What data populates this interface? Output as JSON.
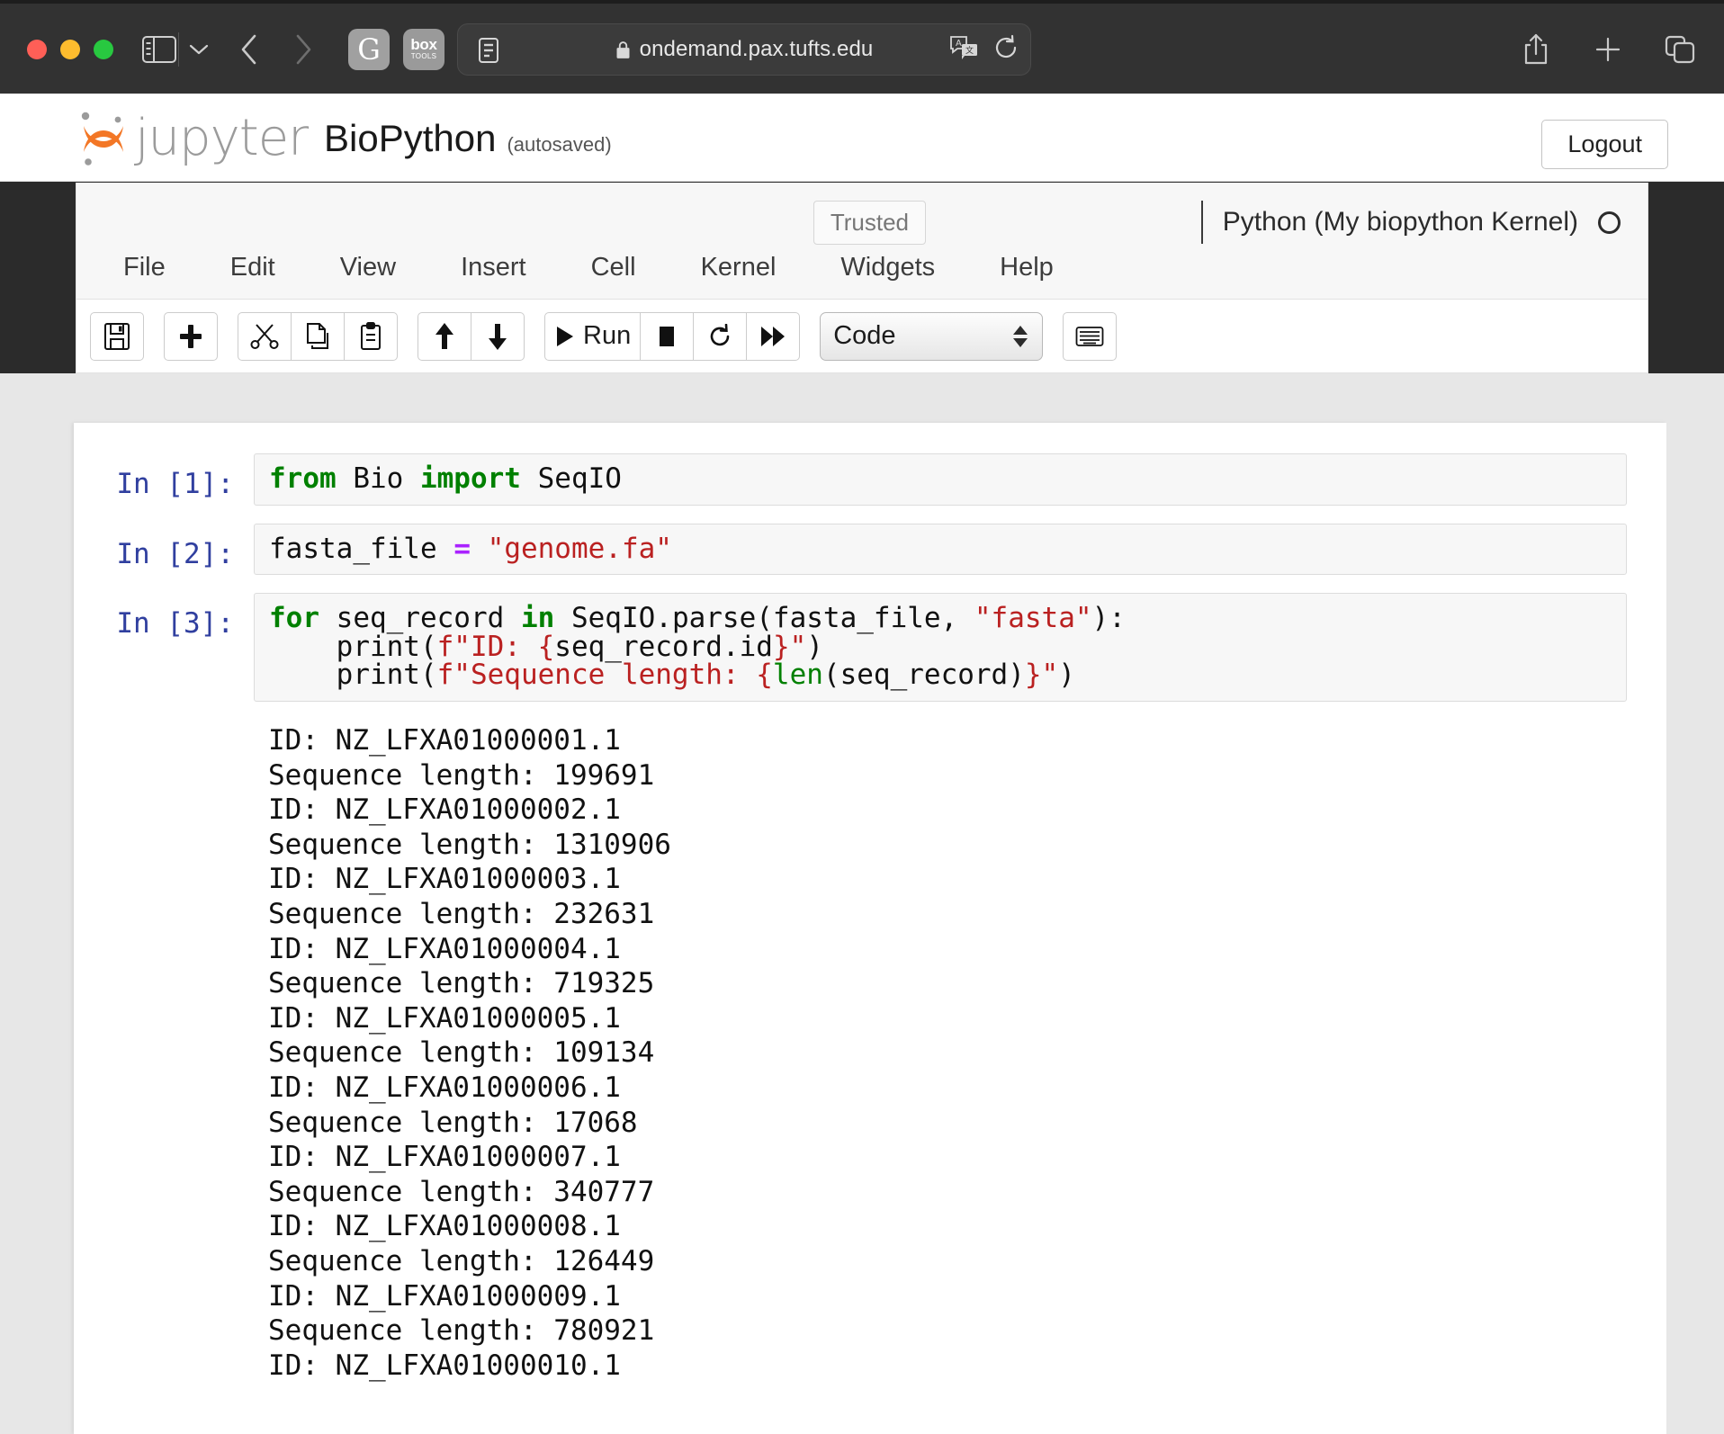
{
  "browser": {
    "url": "ondemand.pax.tufts.edu",
    "icons": {
      "sidebar": "sidebar-toggle-icon",
      "chevron": "chevron-down-icon",
      "back": "back-arrow-icon",
      "forward": "forward-arrow-icon",
      "grammarly": "grammarly-extension-icon",
      "box_top": "box",
      "box_bottom": "TOOLS",
      "reader": "reader-view-icon",
      "lock": "lock-icon",
      "translate": "translate-icon",
      "reload": "reload-icon",
      "share": "share-icon",
      "new_tab": "plus-icon",
      "tab_overview": "tab-overview-icon"
    }
  },
  "jupyter": {
    "logo_text": "jupyter",
    "notebook_name": "BioPython",
    "save_status": "(autosaved)",
    "logout_label": "Logout",
    "trusted_label": "Trusted",
    "kernel_name": "Python (My biopython Kernel)",
    "menu_items": [
      "File",
      "Edit",
      "View",
      "Insert",
      "Cell",
      "Kernel",
      "Widgets",
      "Help"
    ],
    "toolbar": {
      "save_title": "save-icon",
      "insert_title": "plus-icon",
      "cut_title": "scissors-icon",
      "copy_title": "copy-icon",
      "paste_title": "paste-icon",
      "move_up_title": "arrow-up-icon",
      "move_down_title": "arrow-down-icon",
      "run_label": "Run",
      "stop_title": "stop-icon",
      "restart_title": "restart-icon",
      "restart_run_all_title": "fast-forward-icon",
      "cell_type": "Code",
      "keyboard_title": "keyboard-icon"
    }
  },
  "cells": [
    {
      "prompt": "In [1]:",
      "code_html": "<span class=\"k\">from</span> Bio <span class=\"k\">import</span> SeqIO"
    },
    {
      "prompt": "In [2]:",
      "code_html": "fasta_file <span class=\"op\">=</span> <span class=\"s\">\"genome.fa\"</span>"
    },
    {
      "prompt": "In [3]:",
      "code_html": "<span class=\"k\">for</span> seq_record <span class=\"k\">in</span> SeqIO.parse(fasta_file, <span class=\"s\">\"fasta\"</span>):\n    print(<span class=\"s\">f\"ID: {</span>seq_record.id<span class=\"s\">}\"</span>)\n    print(<span class=\"s\">f\"Sequence length: {</span><span class=\"bi\">len</span>(seq_record)<span class=\"s\">}\"</span>)"
    }
  ],
  "output": {
    "records": [
      {
        "id": "NZ_LFXA01000001.1",
        "length": "199691"
      },
      {
        "id": "NZ_LFXA01000002.1",
        "length": "1310906"
      },
      {
        "id": "NZ_LFXA01000003.1",
        "length": "232631"
      },
      {
        "id": "NZ_LFXA01000004.1",
        "length": "719325"
      },
      {
        "id": "NZ_LFXA01000005.1",
        "length": "109134"
      },
      {
        "id": "NZ_LFXA01000006.1",
        "length": "17068"
      },
      {
        "id": "NZ_LFXA01000007.1",
        "length": "340777"
      },
      {
        "id": "NZ_LFXA01000008.1",
        "length": "126449"
      },
      {
        "id": "NZ_LFXA01000009.1",
        "length": "780921"
      },
      {
        "id": "NZ_LFXA01000010.1",
        "length": null
      }
    ],
    "id_prefix": "ID: ",
    "len_prefix": "Sequence length: ",
    "text": "ID: NZ_LFXA01000001.1\nSequence length: 199691\nID: NZ_LFXA01000002.1\nSequence length: 1310906\nID: NZ_LFXA01000003.1\nSequence length: 232631\nID: NZ_LFXA01000004.1\nSequence length: 719325\nID: NZ_LFXA01000005.1\nSequence length: 109134\nID: NZ_LFXA01000006.1\nSequence length: 17068\nID: NZ_LFXA01000007.1\nSequence length: 340777\nID: NZ_LFXA01000008.1\nSequence length: 126449\nID: NZ_LFXA01000009.1\nSequence length: 780921\nID: NZ_LFXA01000010.1"
  },
  "colors": {
    "chrome_bg": "#323232",
    "keyword_green": "#008000",
    "string_red": "#ba2121",
    "operator_purple": "#aa22ff",
    "prompt_blue": "#303f9f",
    "jupyter_orange": "#f37726"
  }
}
